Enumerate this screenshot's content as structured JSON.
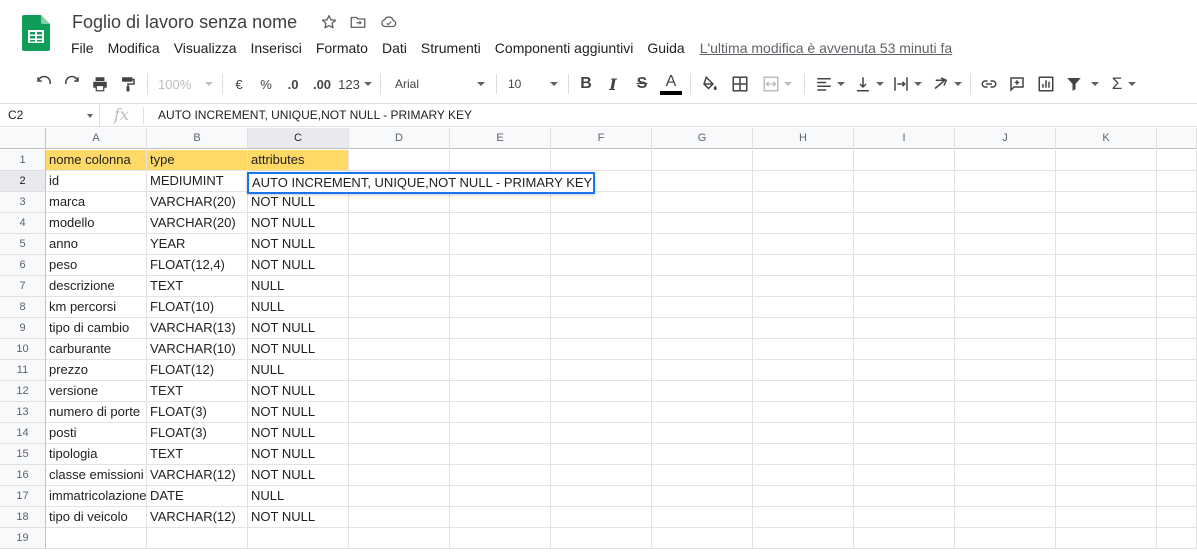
{
  "app": {
    "title": "Foglio di lavoro senza nome",
    "brand_color": "#0F9D58",
    "icons": [
      "star-icon",
      "move-to-folder-icon",
      "cloud-status-icon"
    ]
  },
  "menu": {
    "items": [
      "File",
      "Modifica",
      "Visualizza",
      "Inserisci",
      "Formato",
      "Dati",
      "Strumenti",
      "Componenti aggiuntivi",
      "Guida"
    ],
    "last_edit": "L'ultima modifica è avvenuta 53 minuti fa"
  },
  "toolbar": {
    "zoom": "100%",
    "currency": "€",
    "percent": "%",
    "decrease_decimals": ".0",
    "increase_decimals": ".00",
    "number_format": "123",
    "font": "Arial",
    "font_size": "10",
    "bold": "B",
    "italic": "I",
    "strikethrough": "S",
    "text_color_glyph": "A",
    "text_color": "#000000",
    "sum_glyph": "Σ"
  },
  "formula_bar": {
    "cell_ref": "C2",
    "fx": "fx",
    "content": "AUTO INCREMENT, UNIQUE,NOT NULL - PRIMARY KEY"
  },
  "grid": {
    "columns": [
      "A",
      "B",
      "C",
      "D",
      "E",
      "F",
      "G",
      "H",
      "I",
      "J",
      "K"
    ],
    "selected_column": "C",
    "selected_row": "2",
    "header_fill": "#FFD966",
    "row_numbers": [
      "1",
      "2",
      "3",
      "4",
      "5",
      "6",
      "7",
      "8",
      "9",
      "10",
      "11",
      "12",
      "13",
      "14",
      "15",
      "16",
      "17",
      "18",
      "19"
    ],
    "rows": [
      [
        "nome colonna",
        "type",
        "attributes"
      ],
      [
        "id",
        "MEDIUMINT",
        "AUTO INCREMENT, UNIQUE,NOT NULL - PRIMARY KEY"
      ],
      [
        "marca",
        "VARCHAR(20)",
        "NOT NULL"
      ],
      [
        "modello",
        "VARCHAR(20)",
        "NOT NULL"
      ],
      [
        "anno",
        "YEAR",
        "NOT NULL"
      ],
      [
        "peso",
        "FLOAT(12,4)",
        "NOT NULL"
      ],
      [
        "descrizione",
        "TEXT",
        "NULL"
      ],
      [
        "km percorsi",
        "FLOAT(10)",
        "NULL"
      ],
      [
        "tipo di cambio",
        "VARCHAR(13)",
        "NOT NULL"
      ],
      [
        "carburante",
        "VARCHAR(10)",
        "NOT NULL"
      ],
      [
        "prezzo",
        "FLOAT(12)",
        "NULL"
      ],
      [
        "versione",
        "TEXT",
        "NOT NULL"
      ],
      [
        "numero di porte",
        "FLOAT(3)",
        "NOT NULL"
      ],
      [
        "posti",
        "FLOAT(3)",
        "NOT NULL"
      ],
      [
        "tipologia",
        "TEXT",
        "NOT NULL"
      ],
      [
        "classe emissioni",
        "VARCHAR(12)",
        "NOT NULL"
      ],
      [
        "immatricolazione",
        "DATE",
        "NULL"
      ],
      [
        "tipo di veicolo",
        "VARCHAR(12)",
        "NOT NULL"
      ],
      [
        "",
        "",
        ""
      ]
    ],
    "editor_value": "AUTO INCREMENT, UNIQUE,NOT NULL - PRIMARY KEY",
    "editor_overflow_tail": "Y"
  }
}
